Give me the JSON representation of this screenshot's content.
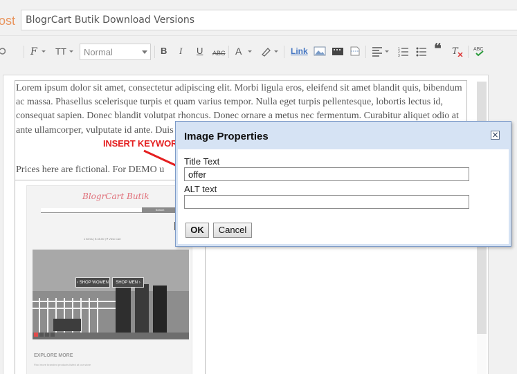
{
  "header": {
    "post_label": "ost",
    "title_value": "BlogrCart Butik Download Versions"
  },
  "toolbar": {
    "font_size_value": "Normal",
    "link_label": "Link"
  },
  "editor": {
    "paragraph": "Lorem ipsum dolor sit amet, consectetur adipiscing elit. Morbi ligula eros, eleifend sit amet blandit quis, bibendum ac massa. Phasellus scelerisque turpis et quam varius tempor. Nulla eget turpis pellentesque, lobortis lectus id, consequat sapien. Donec blandit volutpat rhoncus. Donec ornare a metus nec fermentum. Curabitur aliquet odio at ante ullamcorper, vulputate id ante. Duis scelerisque",
    "prices_note": "Prices here are fictional. For DEMO u"
  },
  "store_preview": {
    "logo": "BlogrCart Butik",
    "search_button": "Search",
    "cart_info": "1 items  |  $ 45.00  |  ♥ View Cart",
    "shop_women": "‹ SHOP WOMEN",
    "shop_men": "SHOP MEN ›",
    "explore_title": "EXPLORE MORE",
    "explore_subtitle": "Find more branded products listed at our store"
  },
  "annotation": {
    "text": "INSERT KEYWORD HERE",
    "color": "#e41f20"
  },
  "dialog": {
    "title": "Image Properties",
    "close_symbol": "×",
    "title_text_label": "Title Text",
    "title_text_value": "offer",
    "alt_text_label": "ALT text",
    "alt_text_value": "",
    "ok_label": "OK",
    "cancel_label": "Cancel"
  }
}
